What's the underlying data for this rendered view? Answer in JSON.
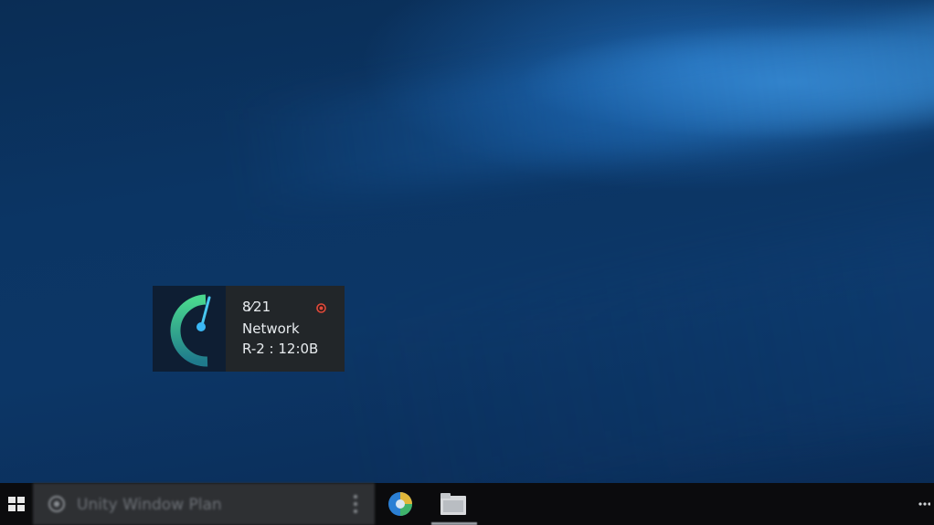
{
  "widget": {
    "line1": "8⁄21",
    "line2": "Network",
    "line3": "R-2 : 12:0B",
    "accent_color": "#3ec9a0",
    "status_icon": "red-status-dot-icon"
  },
  "taskbar": {
    "search_text": "Unity Window Plan",
    "search_icon": "search-circle-icon",
    "apps": [
      {
        "name": "browser-icon"
      },
      {
        "name": "file-explorer-icon",
        "active": true
      }
    ]
  }
}
